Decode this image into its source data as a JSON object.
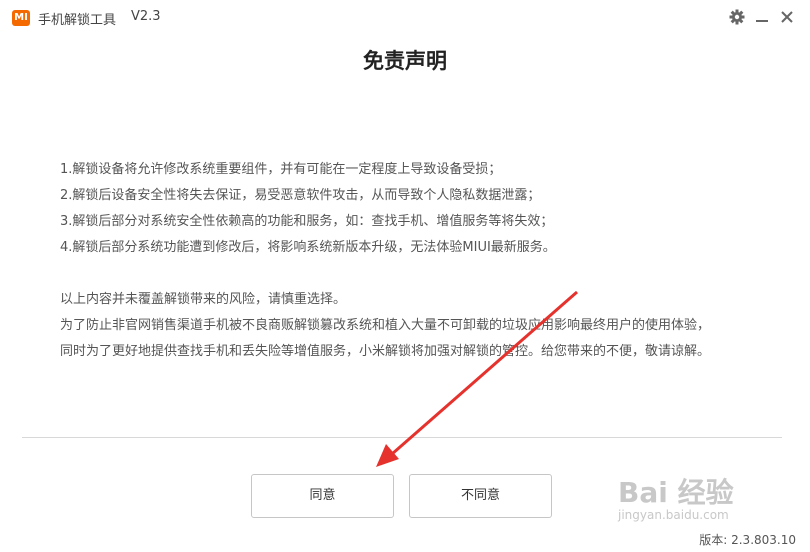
{
  "titlebar": {
    "logo_text": "MI",
    "app_name": "手机解锁工具",
    "version": "V2.3"
  },
  "page": {
    "title": "免责声明",
    "lines": [
      "1.解锁设备将允许修改系统重要组件，并有可能在一定程度上导致设备受损；",
      "2.解锁后设备安全性将失去保证，易受恶意软件攻击，从而导致个人隐私数据泄露；",
      "3.解锁后部分对系统安全性依赖高的功能和服务，如：查找手机、增值服务等将失效；",
      "4.解锁后部分系统功能遭到修改后，将影响系统新版本升级，无法体验MIUI最新服务。"
    ],
    "notes": [
      "以上内容并未覆盖解锁带来的风险，请慎重选择。",
      "为了防止非官网销售渠道手机被不良商贩解锁篡改系统和植入大量不可卸载的垃圾应用影响最终用户的使用体验，",
      "同时为了更好地提供查找手机和丢失险等增值服务，小米解锁将加强对解锁的管控。给您带来的不便，敬请谅解。"
    ]
  },
  "buttons": {
    "agree": "同意",
    "disagree": "不同意"
  },
  "footer": {
    "version_label": "版本: 2.3.803.10"
  },
  "watermark": {
    "logo": "Bai 经验",
    "url": "jingyan.baidu.com"
  },
  "colors": {
    "brand": "#f56a00",
    "arrow": "#e5322d"
  },
  "icons": [
    "gear-icon",
    "minimize-icon",
    "close-icon",
    "red-arrow"
  ]
}
